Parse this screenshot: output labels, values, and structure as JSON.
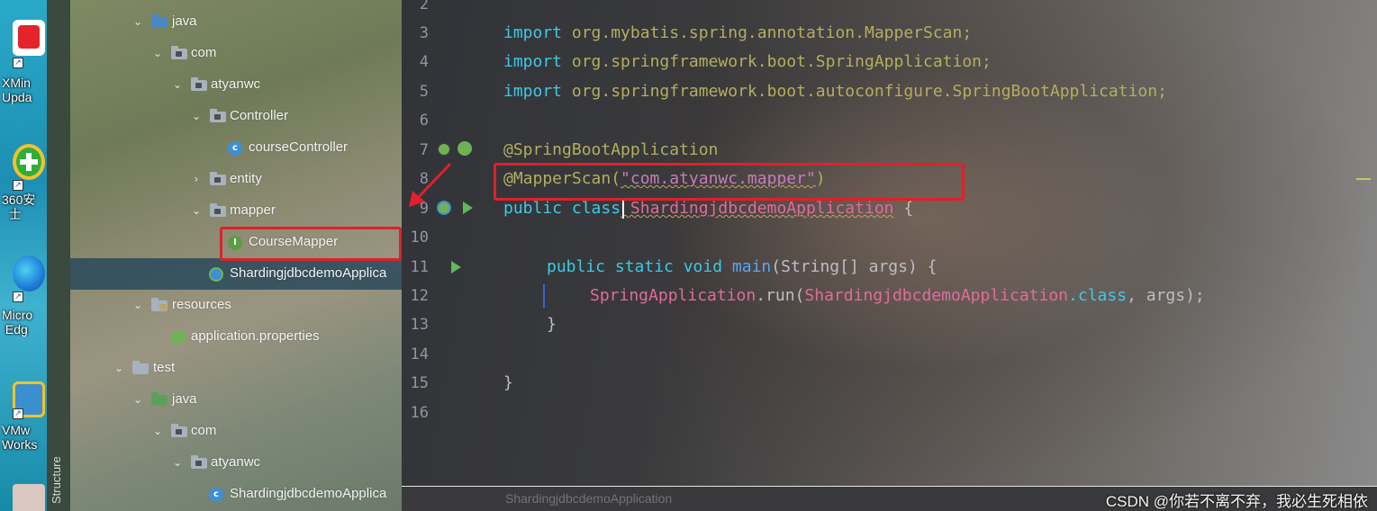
{
  "desktop": {
    "icons": [
      {
        "name": "xmind",
        "label": "XMin\nUpda",
        "color": "#e3242b"
      },
      {
        "name": "360-safe",
        "label": "360安\n  士",
        "color": "#2fae3a"
      },
      {
        "name": "edge",
        "label": "Micro\n Edg",
        "color": "#1f7bd8"
      },
      {
        "name": "vmware",
        "label": "VMw\nWorks",
        "color": "#3a8fd0"
      }
    ]
  },
  "structure_label": "Structure",
  "tree": {
    "java": "java",
    "com": "com",
    "atyanwc": "atyanwc",
    "controller": "Controller",
    "course_controller": "courseController",
    "entity": "entity",
    "mapper": "mapper",
    "course_mapper": "CourseMapper",
    "app_main": "ShardingjdbcdemoApplica",
    "resources": "resources",
    "app_props": "application.properties",
    "test": "test",
    "test_java": "java",
    "test_com": "com",
    "test_atyanwc": "atyanwc",
    "app_test": "ShardingjdbcdemoApplica"
  },
  "editor": {
    "line_numbers": [
      "2",
      "3",
      "4",
      "5",
      "6",
      "7",
      "8",
      "9",
      "10",
      "11",
      "12",
      "13",
      "14",
      "15",
      "16"
    ],
    "code": {
      "l3_kw": "import",
      "l3_rest": " org.mybatis.spring.annotation.MapperScan;",
      "l4_kw": "import",
      "l4_rest": " org.springframework.boot.SpringApplication;",
      "l5_kw": "import",
      "l5_rest": " org.springframework.boot.autoconfigure.SpringBootApplication;",
      "l7": "@SpringBootApplication",
      "l8_ann": "@MapperScan(",
      "l8_str": "\"com.atyanwc.mapper\"",
      "l8_close": ")",
      "l9_kw1": "public",
      "l9_kw2": " class",
      "l9_cls": " ShardingjdbcdemoApplication",
      "l9_brace": " {",
      "l11_kw": "public static void",
      "l11_mth": " main",
      "l11_rest": "(String[] args) {",
      "l12_cls": "SpringApplication",
      "l12_mth": ".run(",
      "l12_arg": "ShardingjdbcdemoApplication",
      "l12_kw": ".class",
      "l12_rest": ", args);",
      "l13": "}",
      "l15": "}"
    },
    "breadcrumb": "ShardingjdbcdemoApplication"
  },
  "watermark": "CSDN @你若不离不弃，我必生死相依",
  "colors": {
    "highlight": "#e0202a",
    "keyword": "#cf8e6d",
    "annotation": "#b3ae60",
    "string": "#6aab73"
  }
}
